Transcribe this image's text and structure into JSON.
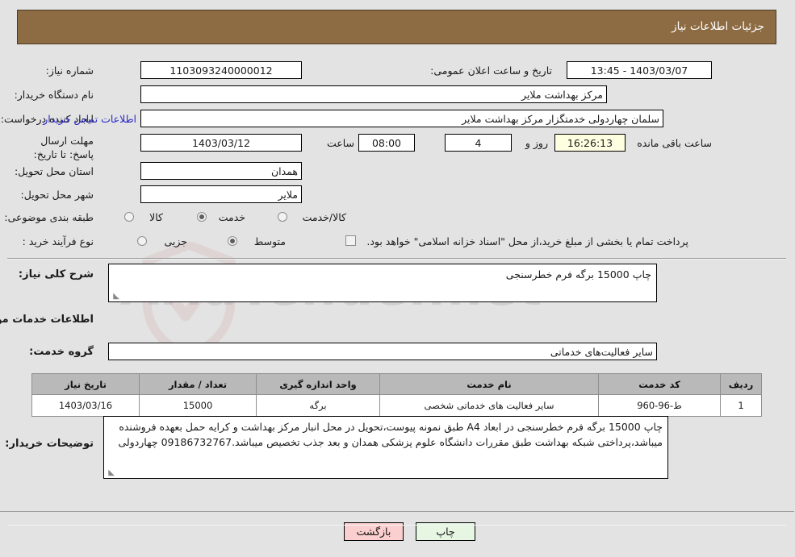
{
  "window": {
    "title": "جزئیات اطلاعات نیاز"
  },
  "watermark": {
    "text": "AriaTender.net"
  },
  "form": {
    "need_number_label": "شماره نیاز:",
    "need_number_value": "1103093240000012",
    "public_announce_label": "تاریخ و ساعت اعلان عمومی:",
    "public_announce_value": "1403/03/07 - 13:45",
    "buyer_org_label": "نام دستگاه خریدار:",
    "buyer_org_value": "مرکز بهداشت ملایر",
    "creator_label": "ایجاد کننده درخواست:",
    "creator_value": "سلمان چهاردولی خدمتگزار مرکز بهداشت ملایر",
    "contact_link": "اطلاعات تماس خریدار",
    "deadline_label": "مهلت ارسال پاسخ: تا تاریخ:",
    "deadline_date": "1403/03/12",
    "deadline_hour_label": "ساعت",
    "deadline_hour": "08:00",
    "remaining_days": "4",
    "remaining_days_label": "روز و",
    "remaining_time": "16:26:13",
    "remaining_time_label": "ساعت باقی مانده",
    "province_label": "استان محل تحویل:",
    "province_value": "همدان",
    "city_label": "شهر محل تحویل:",
    "city_value": "ملایر",
    "category_label": "طبقه بندی موضوعی:",
    "category_options": [
      {
        "label": "کالا",
        "selected": false
      },
      {
        "label": "خدمت",
        "selected": true
      },
      {
        "label": "کالا/خدمت",
        "selected": false
      }
    ],
    "process_label": "نوع فرآیند خرید :",
    "process_options": [
      {
        "label": "جزیی",
        "selected": false
      },
      {
        "label": "متوسط",
        "selected": true
      }
    ],
    "treasury_checkbox_checked": false,
    "treasury_text": "پرداخت تمام یا بخشی از مبلغ خرید،از محل \"اسناد خزانه اسلامی\" خواهد بود."
  },
  "need": {
    "general_desc_label": "شرح کلی نیاز:",
    "general_desc_value": "چاپ 15000 برگه فرم خطرسنجی",
    "services_heading": "اطلاعات خدمات مورد نیاز",
    "service_group_label": "گروه خدمت:",
    "service_group_value": "سایر فعالیت‌های خدماتی"
  },
  "table": {
    "columns": [
      "ردیف",
      "کد خدمت",
      "نام خدمت",
      "واحد اندازه گیری",
      "تعداد / مقدار",
      "تاریخ نیاز"
    ],
    "rows": [
      {
        "index": "1",
        "service_code": "ط-96-960",
        "service_name": "سایر فعالیت های خدماتی شخصی",
        "unit": "برگه",
        "quantity": "15000",
        "need_date": "1403/03/16"
      }
    ]
  },
  "buyer_notes": {
    "label": "توضیحات خریدار:",
    "value": "چاپ 15000 برگه فرم خطرسنجی در ابعاد A4 طبق نمونه پیوست،تحویل در محل انبار مرکز بهداشت و کرایه حمل بعهده فروشنده میباشد،پرداختی شبکه بهداشت طبق مقررات دانشگاه علوم پزشکی همدان و بعد جذب تخصیص میباشد.09186732767 چهاردولی"
  },
  "footer": {
    "print_label": "چاپ",
    "back_label": "بازگشت"
  },
  "colors": {
    "titlebar": "#8d6c43",
    "page_bg": "#e3e3e3",
    "table_header": "#b9b9b9",
    "link": "#2a28c8",
    "print_btn": "#e6f6e3",
    "back_btn": "#fbcfcf",
    "countdown_bg": "#feffe0"
  }
}
